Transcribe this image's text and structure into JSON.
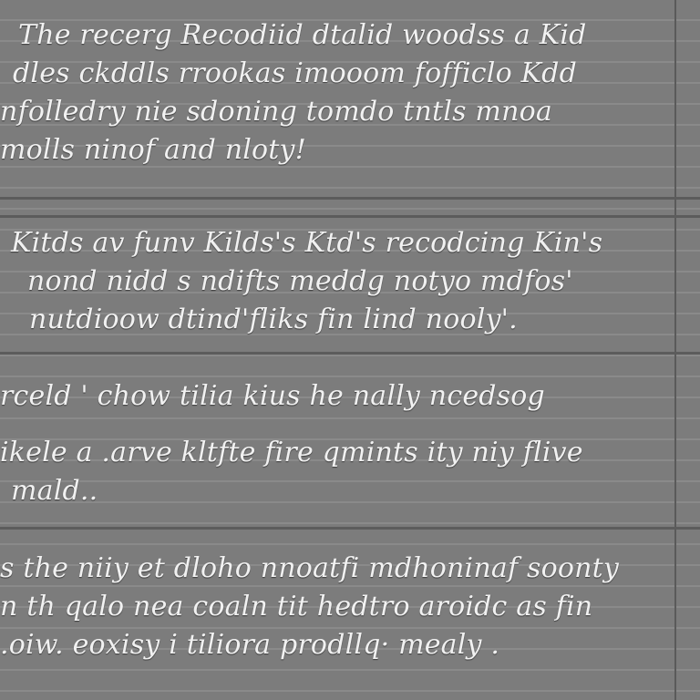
{
  "blocks": [
    {
      "lines": [
        "The recerg Recodiid dtalid woodss a Kid",
        "dles ckddls rrookas imooom fofficlo Kdd",
        "nfolledry nie sdoning tomdo tntls mnoa",
        "molls ninof and nloty!"
      ]
    },
    {
      "lines": [
        "Kitds av funv Kilds's  Ktd's recodcing  Kin's",
        "nond nidd s ndifts meddg notyo mdfos'",
        "nutdioow dtind'fliks fin lind nooly'."
      ]
    },
    {
      "lines": [
        "rceld ' chow tilia kius he  nally ncedsog",
        "ikele a .arve  kltfte  fire qmints ity niy flive",
        "mald.."
      ]
    },
    {
      "lines": [
        "s the niiy et dloho nnoatfi mdhoninaf soonty",
        "n th qalo nea coaln tit hedtro aroidc  as fin",
        ".oiw. eoxisy i tiliora prodllq·  mealy ."
      ]
    }
  ]
}
